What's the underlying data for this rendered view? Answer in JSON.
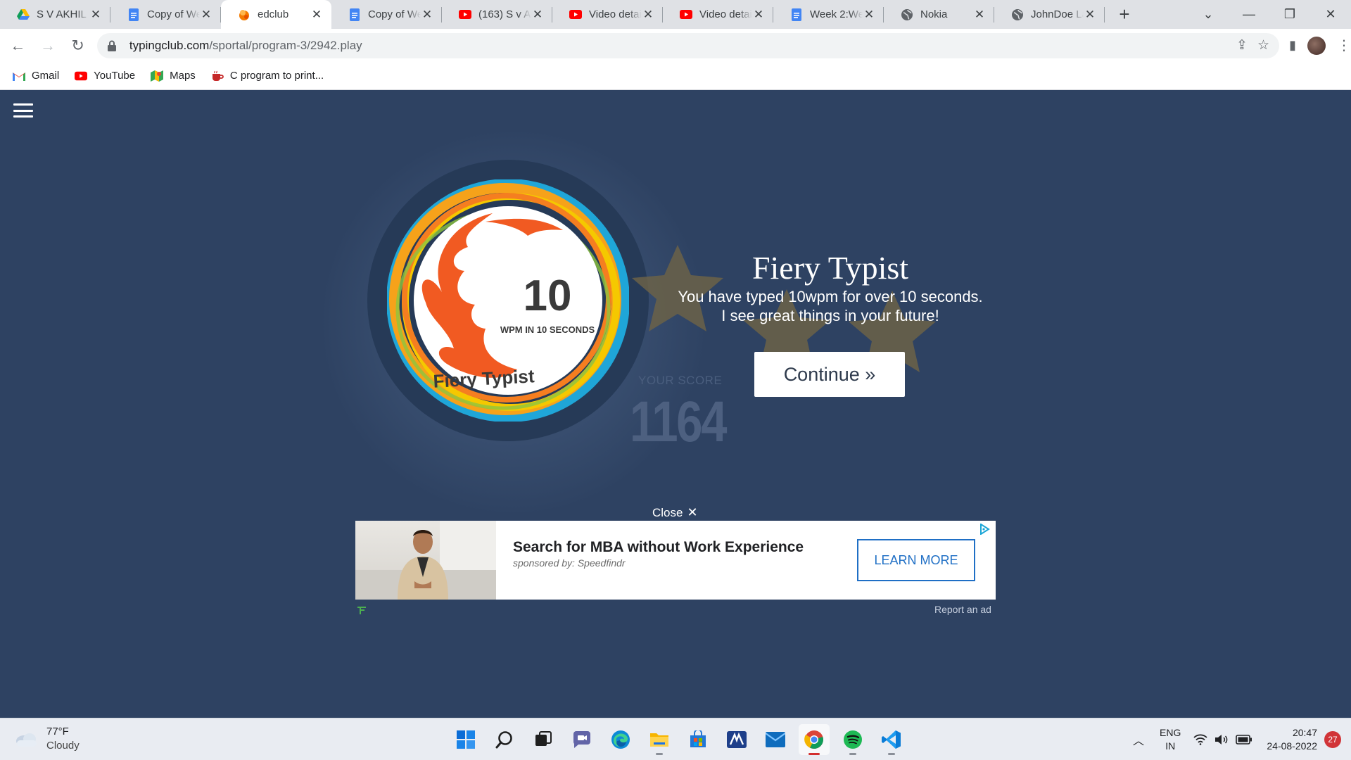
{
  "browser": {
    "tabs": [
      {
        "label": "S V AKHIL R",
        "icon": "google-drive-icon",
        "active": false
      },
      {
        "label": "Copy of We",
        "icon": "google-docs-icon",
        "active": false
      },
      {
        "label": "edclub",
        "icon": "edclub-icon",
        "active": true
      },
      {
        "label": "Copy of We",
        "icon": "google-docs-icon",
        "active": false
      },
      {
        "label": "(163) S v Ak",
        "icon": "youtube-icon",
        "active": false
      },
      {
        "label": "Video detail",
        "icon": "youtube-icon",
        "active": false
      },
      {
        "label": "Video detail",
        "icon": "youtube-icon",
        "active": false
      },
      {
        "label": "Week 2:Wel",
        "icon": "google-docs-icon",
        "active": false
      },
      {
        "label": "Nokia",
        "icon": "globe-icon",
        "active": false
      },
      {
        "label": "JohnDoe La",
        "icon": "globe-icon",
        "active": false
      }
    ],
    "url_host": "typingclub.com",
    "url_path": "/sportal/program-3/2942.play",
    "bookmarks": [
      {
        "label": "Gmail",
        "icon": "gmail-icon"
      },
      {
        "label": "YouTube",
        "icon": "youtube-icon"
      },
      {
        "label": "Maps",
        "icon": "maps-icon"
      },
      {
        "label": "C program to print...",
        "icon": "java-cup-icon"
      }
    ]
  },
  "badge": {
    "number": "10",
    "subtitle": "WPM IN 10 SECONDS",
    "name": "Fiery Typist"
  },
  "score": {
    "label": "YOUR SCORE",
    "value": "1164"
  },
  "award": {
    "title": "Fiery Typist",
    "line1": "You have typed 10wpm for over 10 seconds.",
    "line2": "I see great things in your future!",
    "continue_label": "Continue »"
  },
  "ad": {
    "close_label": "Close",
    "headline": "Search for MBA without Work Experience",
    "sponsor": "sponsored by: Speedfindr",
    "cta": "LEARN MORE",
    "report": "Report an ad"
  },
  "taskbar": {
    "weather_temp": "77°F",
    "weather_desc": "Cloudy",
    "lang_top": "ENG",
    "lang_bottom": "IN",
    "time": "20:47",
    "date": "24-08-2022",
    "notifications": "27"
  },
  "colors": {
    "page_bg": "#2e4262",
    "flame": "#f15a22",
    "cta_blue": "#1f6fc5",
    "star": "#6b6148"
  }
}
